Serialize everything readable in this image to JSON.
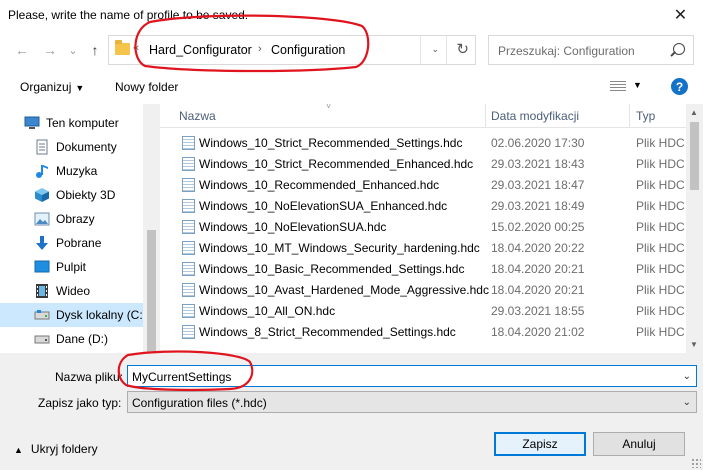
{
  "window": {
    "title": "Please, write the name of profile to be saved.",
    "close_glyph": "✕"
  },
  "navigation": {
    "back_glyph": "←",
    "forward_glyph": "→",
    "recent_glyph": "⌄",
    "up_glyph": "↑"
  },
  "address_bar": {
    "overflow_glyph": "«",
    "crumbs": [
      "Hard_Configurator",
      "Configuration"
    ],
    "separator": "›",
    "dropdown_glyph": "⌄",
    "refresh_glyph": "↻"
  },
  "search": {
    "placeholder": "Przeszukaj: Configuration"
  },
  "toolbar": {
    "organize_label": "Organizuj",
    "organize_caret": "▼",
    "new_folder_label": "Nowy folder",
    "view_dropdown": "▼",
    "help_label": "?"
  },
  "nav_pane": {
    "items": [
      {
        "label": "Ten komputer",
        "icon": "computer-icon",
        "selected": false
      },
      {
        "label": "Dokumenty",
        "icon": "documents-icon",
        "selected": false
      },
      {
        "label": "Muzyka",
        "icon": "music-icon",
        "selected": false
      },
      {
        "label": "Obiekty 3D",
        "icon": "objects3d-icon",
        "selected": false
      },
      {
        "label": "Obrazy",
        "icon": "pictures-icon",
        "selected": false
      },
      {
        "label": "Pobrane",
        "icon": "downloads-icon",
        "selected": false
      },
      {
        "label": "Pulpit",
        "icon": "desktop-icon",
        "selected": false
      },
      {
        "label": "Wideo",
        "icon": "video-icon",
        "selected": false
      },
      {
        "label": "Dysk lokalny (C:)",
        "icon": "drive-icon",
        "selected": true
      },
      {
        "label": "Dane (D:)",
        "icon": "drive-icon",
        "selected": false
      }
    ]
  },
  "file_list": {
    "columns": {
      "name": "Nazwa",
      "date": "Data modyfikacji",
      "type": "Typ"
    },
    "sort_glyph": "˅",
    "scroll_up_glyph": "▲",
    "scroll_down_glyph": "▼",
    "rows": [
      {
        "name": "Windows_10_Strict_Recommended_Settings.hdc",
        "date": "02.06.2020 17:30",
        "type": "Plik HDC"
      },
      {
        "name": "Windows_10_Strict_Recommended_Enhanced.hdc",
        "date": "29.03.2021 18:43",
        "type": "Plik HDC"
      },
      {
        "name": "Windows_10_Recommended_Enhanced.hdc",
        "date": "29.03.2021 18:47",
        "type": "Plik HDC"
      },
      {
        "name": "Windows_10_NoElevationSUA_Enhanced.hdc",
        "date": "29.03.2021 18:49",
        "type": "Plik HDC"
      },
      {
        "name": "Windows_10_NoElevationSUA.hdc",
        "date": "15.02.2020 00:25",
        "type": "Plik HDC"
      },
      {
        "name": "Windows_10_MT_Windows_Security_hardening.hdc",
        "date": "18.04.2020 20:22",
        "type": "Plik HDC"
      },
      {
        "name": "Windows_10_Basic_Recommended_Settings.hdc",
        "date": "18.04.2020 20:21",
        "type": "Plik HDC"
      },
      {
        "name": "Windows_10_Avast_Hardened_Mode_Aggressive.hdc",
        "date": "18.04.2020 20:21",
        "type": "Plik HDC"
      },
      {
        "name": "Windows_10_All_ON.hdc",
        "date": "29.03.2021 18:55",
        "type": "Plik HDC"
      },
      {
        "name": "Windows_8_Strict_Recommended_Settings.hdc",
        "date": "18.04.2020 21:02",
        "type": "Plik HDC"
      }
    ]
  },
  "save_form": {
    "filename_label": "Nazwa pliku:",
    "filename_value": "MyCurrentSettings",
    "filetype_label": "Zapisz jako typ:",
    "filetype_value": "Configuration files (*.hdc)",
    "dropdown_glyph": "⌄",
    "hide_folders_label": "Ukryj foldery",
    "hide_folders_caret": "▲",
    "save_label": "Zapisz",
    "cancel_label": "Anuluj"
  },
  "colors": {
    "accent": "#0078d7",
    "selection": "#cce8ff",
    "annotation": "#e0141e"
  }
}
